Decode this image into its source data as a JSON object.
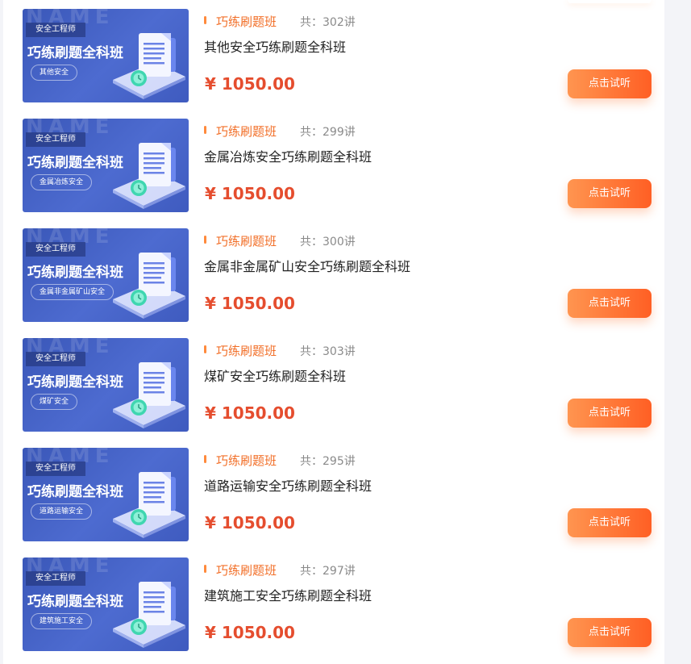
{
  "currency_symbol": "¥",
  "courses": [
    {
      "thumb_watermark": "NAME",
      "thumb_tag": "安全工程师",
      "thumb_headline": "巧练刷题全科班",
      "thumb_pill": "其他安全",
      "category": "巧练刷题班",
      "lessons": "共：302讲",
      "title": "其他安全巧练刷题全科班",
      "price": "¥ 1050.00",
      "button_label": "点击试听"
    },
    {
      "thumb_watermark": "NAME",
      "thumb_tag": "安全工程师",
      "thumb_headline": "巧练刷题全科班",
      "thumb_pill": "金属冶炼安全",
      "category": "巧练刷题班",
      "lessons": "共：299讲",
      "title": "金属冶炼安全巧练刷题全科班",
      "price": "¥ 1050.00",
      "button_label": "点击试听"
    },
    {
      "thumb_watermark": "NAME",
      "thumb_tag": "安全工程师",
      "thumb_headline": "巧练刷题全科班",
      "thumb_pill": "金属非金属矿山安全",
      "category": "巧练刷题班",
      "lessons": "共：300讲",
      "title": "金属非金属矿山安全巧练刷题全科班",
      "price": "¥ 1050.00",
      "button_label": "点击试听"
    },
    {
      "thumb_watermark": "NAME",
      "thumb_tag": "安全工程师",
      "thumb_headline": "巧练刷题全科班",
      "thumb_pill": "煤矿安全",
      "category": "巧练刷题班",
      "lessons": "共：303讲",
      "title": "煤矿安全巧练刷题全科班",
      "price": "¥ 1050.00",
      "button_label": "点击试听"
    },
    {
      "thumb_watermark": "NAME",
      "thumb_tag": "安全工程师",
      "thumb_headline": "巧练刷题全科班",
      "thumb_pill": "道路运输安全",
      "category": "巧练刷题班",
      "lessons": "共：295讲",
      "title": "道路运输安全巧练刷题全科班",
      "price": "¥ 1050.00",
      "button_label": "点击试听"
    },
    {
      "thumb_watermark": "NAME",
      "thumb_tag": "安全工程师",
      "thumb_headline": "巧练刷题全科班",
      "thumb_pill": "建筑施工安全",
      "category": "巧练刷题班",
      "lessons": "共：297讲",
      "title": "建筑施工安全巧练刷题全科班",
      "price": "¥ 1050.00",
      "button_label": "点击试听"
    }
  ],
  "colors": {
    "accent": "#f26f28",
    "price": "#e54d2e",
    "thumb_bg": "#4d6bd0"
  }
}
